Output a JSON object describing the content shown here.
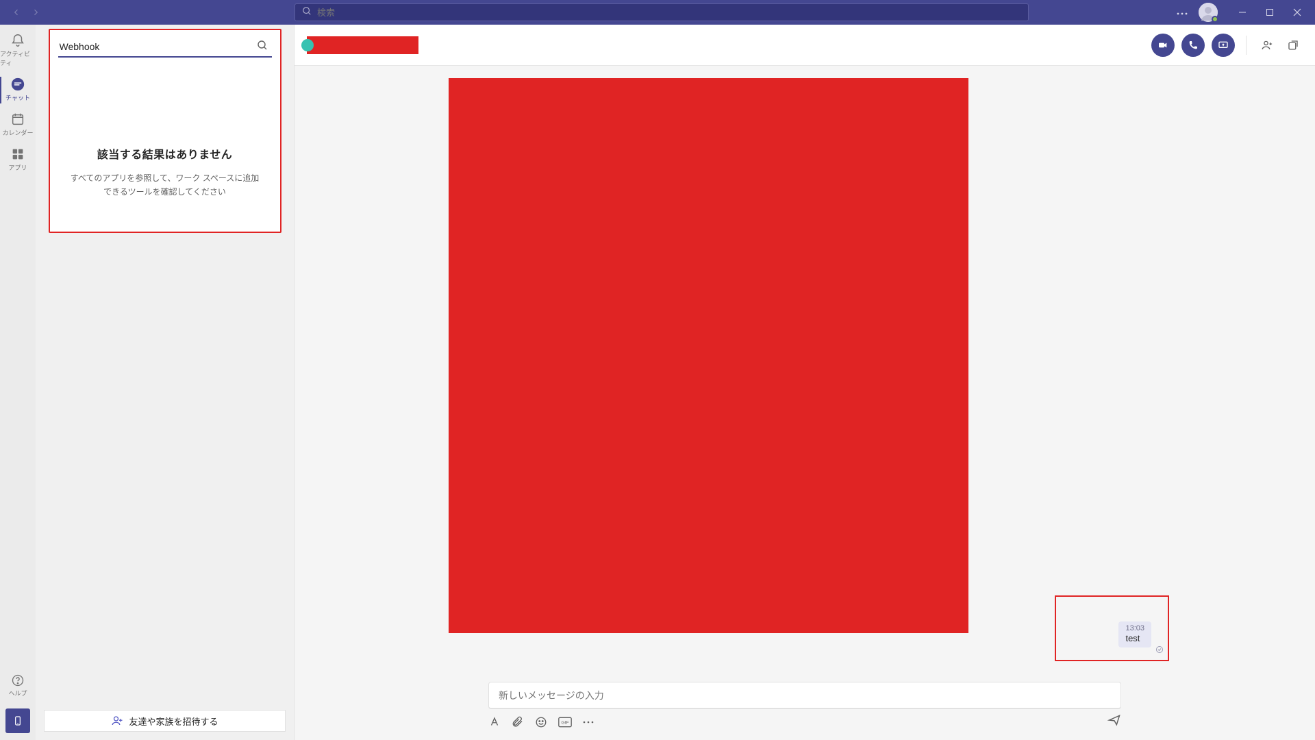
{
  "titlebar": {
    "search_placeholder": "検索"
  },
  "rail": {
    "items": [
      {
        "label": "アクティビティ"
      },
      {
        "label": "チャット"
      },
      {
        "label": "カレンダー"
      },
      {
        "label": "アプリ"
      }
    ],
    "help_label": "ヘルプ"
  },
  "left_panel": {
    "apps_search_value": "Webhook",
    "no_results_title": "該当する結果はありません",
    "no_results_sub": "すべてのアプリを参照して、ワーク スペースに追加できるツールを確認してください",
    "invite_label": "友達や家族を招待する"
  },
  "chat": {
    "message": {
      "time": "13:03",
      "text": "test"
    },
    "composer_placeholder": "新しいメッセージの入力"
  }
}
